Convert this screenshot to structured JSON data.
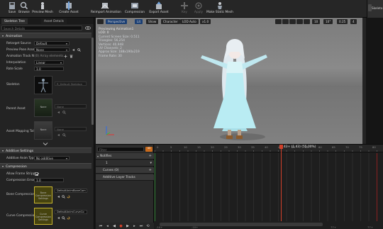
{
  "toolbar": {
    "buttons": [
      {
        "label": "Save",
        "icon": "save-icon"
      },
      {
        "label": "Browse",
        "icon": "browse-icon"
      },
      {
        "label": "Preview Mesh",
        "icon": "preview-mesh-icon"
      },
      {
        "label": "Create Asset",
        "icon": "create-asset-icon"
      },
      {
        "label": "Reimport Animation",
        "icon": "reimport-icon"
      },
      {
        "label": "Compression",
        "icon": "compression-icon"
      },
      {
        "label": "Export Asset",
        "icon": "export-icon"
      },
      {
        "label": "Key",
        "icon": "key-icon",
        "disabled": true
      },
      {
        "label": "Apply",
        "icon": "apply-icon",
        "disabled": true
      },
      {
        "label": "Make Static Mesh",
        "icon": "static-mesh-icon"
      }
    ],
    "right_tab": "Skeleto"
  },
  "left_panel": {
    "tabs": [
      "Skeleton Tree",
      "Asset Details"
    ],
    "search_placeholder": "Search Details",
    "sections": {
      "animation": "Animation",
      "additive": "Additive Settings",
      "compression": "Compression"
    },
    "rows": {
      "retarget_source": {
        "label": "Retarget Source",
        "value": "Default"
      },
      "preview_pose": {
        "label": "Preview Pose Asse",
        "value": "None"
      },
      "animation_track": {
        "label": "Animation Track N",
        "value": "(0) Array elements"
      },
      "interpolation": {
        "label": "Interpolation",
        "value": "Linear"
      },
      "rate_scale": {
        "label": "Rate Scale",
        "value": "1.0"
      },
      "skeleton": {
        "label": "Skeleton",
        "value": "R_Default Skeleton"
      },
      "parent_asset": {
        "label": "Parent Asset",
        "thumb": "None",
        "value": "None"
      },
      "asset_mapping": {
        "label": "Asset Mapping Tal",
        "thumb": "None",
        "value": "None"
      },
      "additive_anim_type": {
        "label": "Additive Anim Typ",
        "value": "No additive"
      },
      "allow_frame_stripping": {
        "label": "Allow Frame Stripp"
      },
      "compression_error": {
        "label": "Compression Error",
        "value": "1.0"
      },
      "bone_compression": {
        "label": "Bone Compression",
        "thumb": "Bone Compression Settings",
        "value": "DefaultAnimBoneCom"
      },
      "curve_compression": {
        "label": "Curve Compression",
        "thumb": "Curve Compression Settings",
        "value": "DefaultAnimCurveCo"
      }
    }
  },
  "viewport": {
    "toolbar": {
      "perspective": "Perspective",
      "lit": "Lit",
      "show": "Show",
      "character": "Character",
      "lod": "LOD Auto",
      "speed": "x1.0",
      "grid_value": "10",
      "angle_value": "10°",
      "scale_value": "0.25",
      "cam_value": "4"
    },
    "info_lines": [
      "Previewing Animation1",
      "LOD: 0",
      "Current Screen Size: 0.511",
      "Triangles: 56,254",
      "Vertices: 40,948",
      "UV Channels: 2",
      "Approx Size: 188x190x219",
      "Frame Rate: 30"
    ]
  },
  "timeline": {
    "filter_placeholder": "Filter",
    "frame_tag": "43",
    "current_time": "43+ (1.43) (55.00%)",
    "tracks": [
      "Notifies",
      "1",
      "Curves (0)",
      "Additive Layer Tracks"
    ],
    "ruler_labels": [
      "0",
      "5",
      "10",
      "15",
      "20",
      "25",
      "30",
      "35",
      "40",
      "45",
      "50",
      "55",
      "60",
      "65",
      "70",
      "75",
      "80"
    ],
    "bottom_labels": [
      "-10+",
      "-10+",
      "77+",
      "77+"
    ],
    "transport_icons": [
      "skip-back-icon",
      "step-back-icon",
      "play-reverse-icon",
      "record-icon",
      "play-icon",
      "step-forward-icon",
      "skip-forward-icon",
      "loop-icon"
    ]
  },
  "colors": {
    "accent_blue": "#1b3f74",
    "playhead": "#d1402a",
    "frame_tag": "#c86a1c",
    "compression_thumb": "#c9b630"
  }
}
